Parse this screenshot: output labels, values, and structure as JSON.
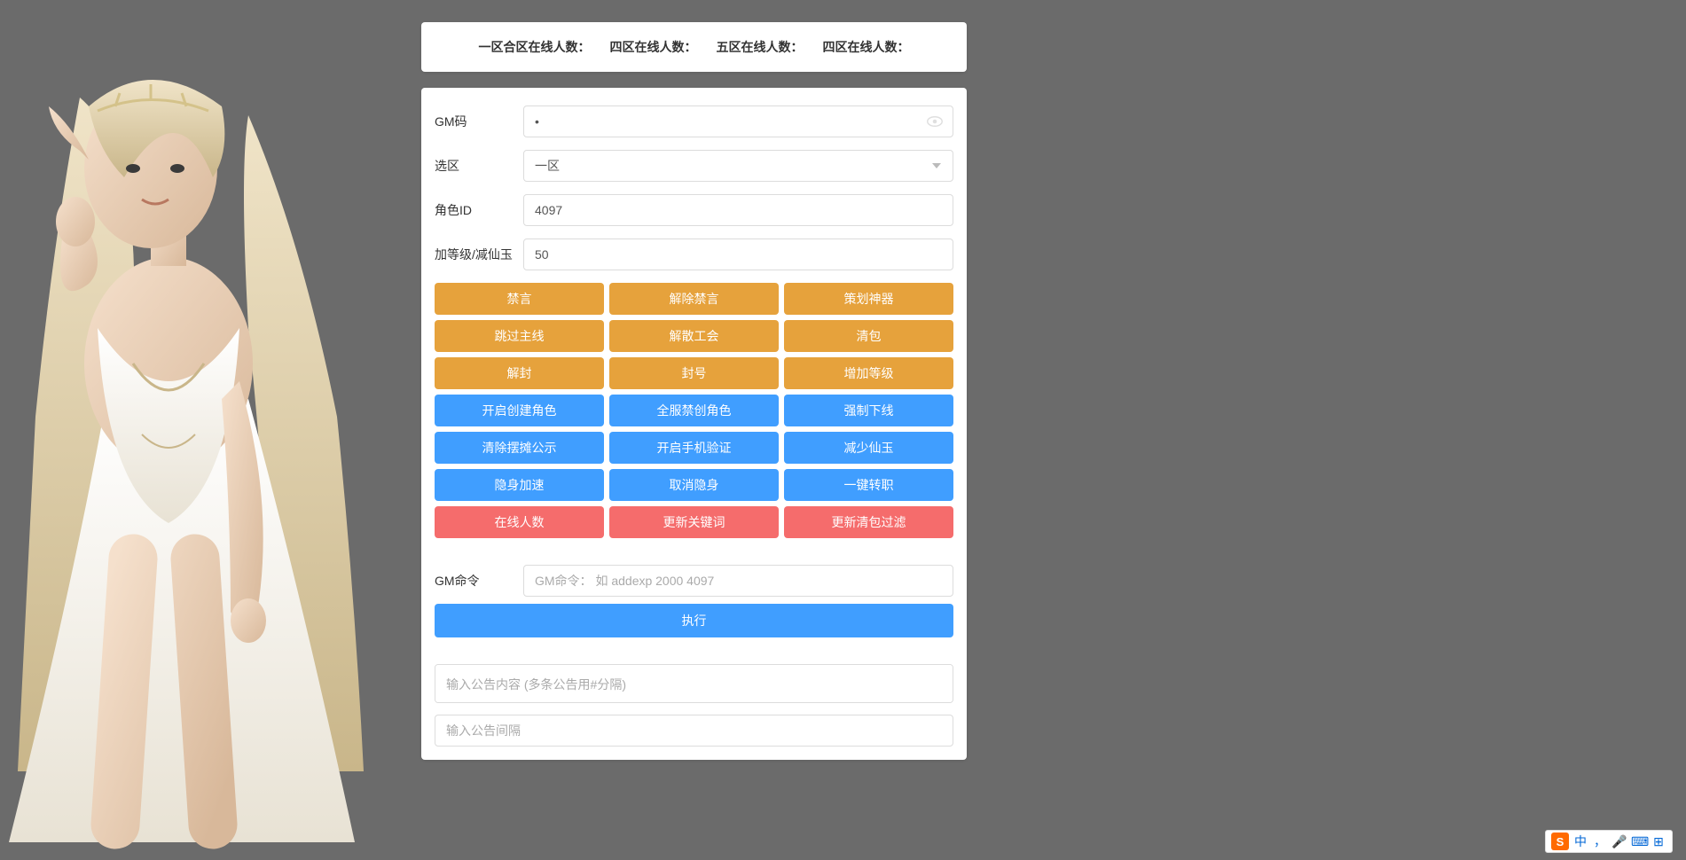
{
  "header": {
    "zone1": "一区合区在线人数：",
    "zone4a": "四区在线人数：",
    "zone5": "五区在线人数：",
    "zone4b": "四区在线人数："
  },
  "form": {
    "gm_code_label": "GM码",
    "gm_code_value": "•",
    "zone_select_label": "选区",
    "zone_select_value": "一区",
    "role_id_label": "角色ID",
    "role_id_value": "4097",
    "level_label": "加等级/减仙玉",
    "level_value": "50"
  },
  "buttons": {
    "r1c1": "禁言",
    "r1c2": "解除禁言",
    "r1c3": "策划神器",
    "r2c1": "跳过主线",
    "r2c2": "解散工会",
    "r2c3": "清包",
    "r3c1": "解封",
    "r3c2": "封号",
    "r3c3": "增加等级",
    "r4c1": "开启创建角色",
    "r4c2": "全服禁创角色",
    "r4c3": "强制下线",
    "r5c1": "清除摆摊公示",
    "r5c2": "开启手机验证",
    "r5c3": "减少仙玉",
    "r6c1": "隐身加速",
    "r6c2": "取消隐身",
    "r6c3": "一键转职",
    "r7c1": "在线人数",
    "r7c2": "更新关键词",
    "r7c3": "更新清包过滤"
  },
  "cmd": {
    "label": "GM命令",
    "placeholder": "GM命令： 如 addexp 2000 4097",
    "execute": "执行"
  },
  "announce": {
    "content_placeholder": "输入公告内容 (多条公告用#分隔)",
    "interval_placeholder": "输入公告间隔"
  },
  "ime": {
    "s": "S",
    "lang": "中",
    "comma": "，",
    "mic": "🎤",
    "kbd": "⌨",
    "grid": "⊞"
  }
}
